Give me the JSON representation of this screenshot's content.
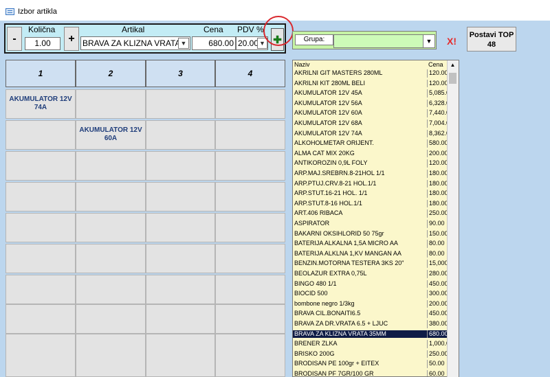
{
  "window": {
    "title": "Izbor artikla",
    "icon": "form-icon"
  },
  "entry": {
    "minus_label": "-",
    "plus_label": "+",
    "qty_label": "Količna",
    "qty_value": "1.00",
    "article_label": "Artikal",
    "article_value": "BRAVA ZA KLIZNA VRATA",
    "price_label": "Cena",
    "price_value": "680.00",
    "pdv_label": "PDV %",
    "pdv_value": "20.00",
    "add_icon": "add-green-icon"
  },
  "group": {
    "label": "Grupa:",
    "value": "",
    "clear_label": "X!",
    "top48_label": "Postavi TOP 48"
  },
  "grid": {
    "columns": [
      "1",
      "2",
      "3",
      "4"
    ],
    "cells": [
      [
        "AKUMULATOR 12V 74A",
        "",
        "",
        ""
      ],
      [
        "",
        "AKUMULATOR 12V 60A",
        "",
        ""
      ],
      [
        "",
        "",
        "",
        ""
      ],
      [
        "",
        "",
        "",
        ""
      ],
      [
        "",
        "",
        "",
        ""
      ],
      [
        "",
        "",
        "",
        ""
      ],
      [
        "",
        "",
        "",
        ""
      ],
      [
        "",
        "",
        "",
        ""
      ],
      [
        "",
        "",
        "",
        ""
      ]
    ]
  },
  "list": {
    "headers": {
      "name": "Naziv",
      "price": "Cena"
    },
    "rows": [
      [
        "AKRILNI GIT MASTERS 280ML",
        "120.00"
      ],
      [
        "AKRILNI KIT 280ML BELI",
        "120.00"
      ],
      [
        "AKUMULATOR 12V 45A",
        "5,085.00"
      ],
      [
        "AKUMULATOR 12V 56A",
        "6,328.00"
      ],
      [
        "AKUMULATOR 12V 60A",
        "7,440.00"
      ],
      [
        "AKUMULATOR 12V 68A",
        "7,004.00"
      ],
      [
        "AKUMULATOR 12V 74A",
        "8,362.00"
      ],
      [
        "ALKOHOLMETAR ORIJENT.",
        "580.00"
      ],
      [
        "ALMA CAT MIX 20KG",
        "200.00"
      ],
      [
        "ANTIKOROZIN 0,9L FOLY",
        "120.00"
      ],
      [
        "ARP.MAJ.SREBRN.8-21HOL 1/1",
        "180.00"
      ],
      [
        "ARP.PTUJ.CRV.8-21 HOL.1/1",
        "180.00"
      ],
      [
        "ARP.STUT.16-21 HOL. 1/1",
        "180.00"
      ],
      [
        "ARP.STUT.8-16 HOL.1/1",
        "180.00"
      ],
      [
        "ART.406 RIBACA",
        "250.00"
      ],
      [
        "ASPIRATOR",
        "90.00"
      ],
      [
        "BAKARNI OKSIHLORID 50 75gr",
        "150.00"
      ],
      [
        "BATERIJA ALKALNA 1,5A MICRO AA",
        "80.00"
      ],
      [
        "BATERIJA ALKLNA 1,KV MANGAN AA",
        "80.00"
      ],
      [
        "BENZIN.MOTORNA TESTERA 3KS 20\"",
        "15,000.00"
      ],
      [
        "BEOLAZUR EXTRA 0,75L",
        "280.00"
      ],
      [
        "BINGO 480 1/1",
        "450.00"
      ],
      [
        "BIOCID 500",
        "300.00"
      ],
      [
        "bombone negro 1/3kg",
        "200.00"
      ],
      [
        "BRAVA CIL.BONAITI6.5",
        "450.00"
      ],
      [
        "BRAVA ZA DR.VRATA 6.5 + LJUC",
        "380.00"
      ],
      [
        "BRAVA ZA KLIZNA VRATA 35MM",
        "680.00"
      ],
      [
        "BRENER ZLKA",
        "1,000.00"
      ],
      [
        "BRISKO 200G",
        "250.00"
      ],
      [
        "BRODISAN PE 100gr + EITEX",
        "50.00"
      ],
      [
        "BRODISAN PF 7GR/100 GR",
        "60.00"
      ]
    ],
    "selected_index": 26
  }
}
